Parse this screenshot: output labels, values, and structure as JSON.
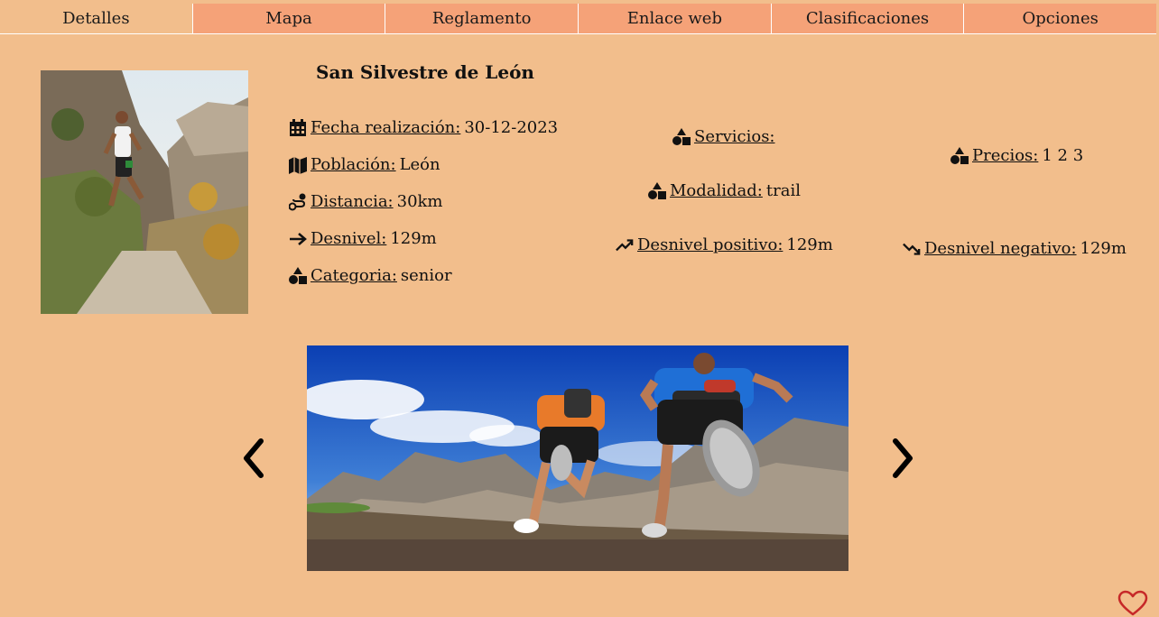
{
  "nav": {
    "tabs": [
      {
        "label": "Detalles",
        "active": true
      },
      {
        "label": "Mapa",
        "active": false
      },
      {
        "label": "Reglamento",
        "active": false
      },
      {
        "label": "Enlace web",
        "active": false
      },
      {
        "label": "Clasificaciones",
        "active": false
      },
      {
        "label": "Opciones",
        "active": false
      }
    ]
  },
  "race": {
    "title": "San Silvestre de León",
    "fecha": {
      "label": "Fecha realización:",
      "value": "30-12-2023",
      "icon": "calendar-icon"
    },
    "poblacion": {
      "label": "Población:",
      "value": "León",
      "icon": "map-icon"
    },
    "distancia": {
      "label": "Distancia:",
      "value": "30km",
      "icon": "route-icon"
    },
    "desnivel": {
      "label": "Desnivel:",
      "value": "129m",
      "icon": "arrow-right-icon"
    },
    "categoria": {
      "label": "Categoria:",
      "value": "senior",
      "icon": "shapes-icon"
    },
    "servicios": {
      "label": "Servicios:",
      "value": "",
      "icon": "shapes-icon"
    },
    "modalidad": {
      "label": "Modalidad:",
      "value": "trail",
      "icon": "shapes-icon"
    },
    "desnivel_positivo": {
      "label": "Desnivel positivo:",
      "value": "129m",
      "icon": "trend-up-icon"
    },
    "precios": {
      "label": "Precios:",
      "value": "1 2 3",
      "icon": "shapes-icon"
    },
    "desnivel_negativo": {
      "label": "Desnivel negativo:",
      "value": "129m",
      "icon": "trend-down-icon"
    }
  },
  "colors": {
    "background": "#f2be8c",
    "tab": "#f5a278",
    "heart": "#c62828"
  }
}
